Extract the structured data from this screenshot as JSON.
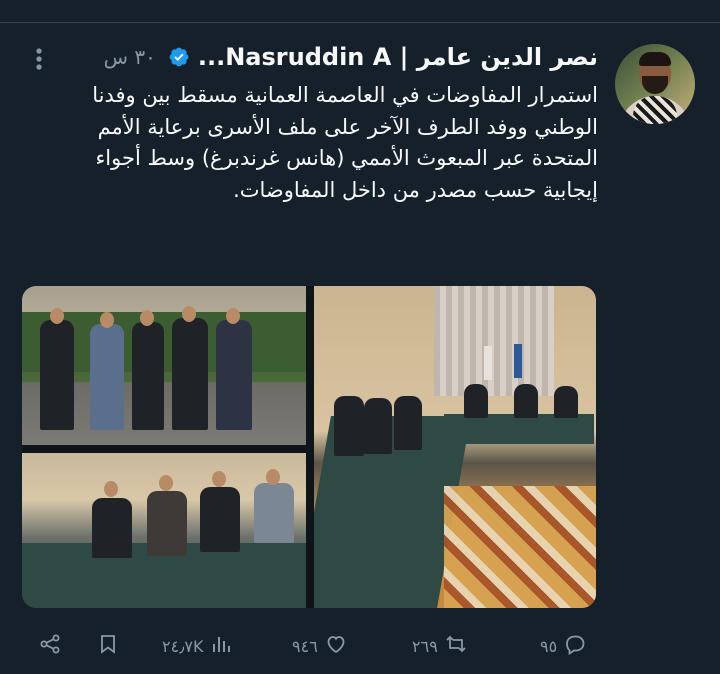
{
  "tweet": {
    "author_name": "نصر الدين عامر | Nasruddin A...",
    "time": "٣٠ س",
    "text": "استمرار المفاوضات في العاصمة العمانية مسقط بين وفدنا الوطني ووفد الطرف الآخر على ملف الأسرى برعاية الأمم المتحدة عبر المبعوث الأممي (هانس غرندبرغ) وسط أجواء إيجابية حسب مصدر من داخل المفاوضات."
  },
  "actions": {
    "replies": "٩٥",
    "retweets": "٢٦٩",
    "likes": "٩٤٦",
    "views": "٢٤٫٧K"
  },
  "icons": {
    "verified": "verified-badge-icon",
    "more": "more-options-icon",
    "reply": "reply-icon",
    "retweet": "retweet-icon",
    "like": "heart-icon",
    "views": "views-icon",
    "bookmark": "bookmark-icon",
    "share": "share-icon"
  },
  "colors": {
    "background": "#15202b",
    "text": "#f7f9f9",
    "secondary": "#8b98a5",
    "verified": "#1d9bf0"
  }
}
